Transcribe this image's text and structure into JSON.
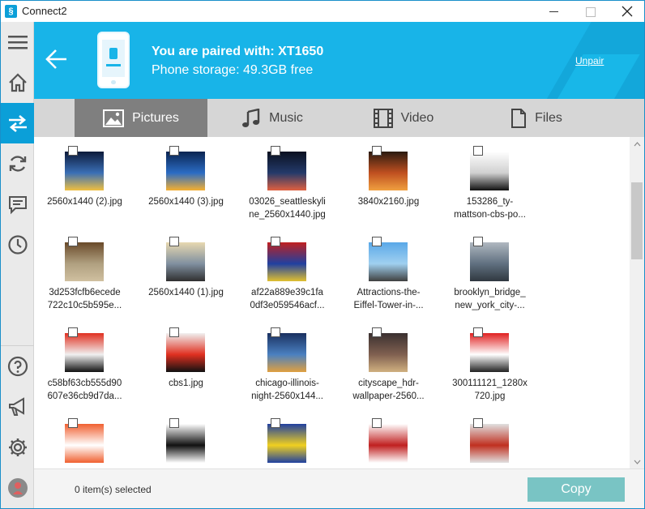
{
  "window": {
    "app_icon": "connect2-logo",
    "title": "Connect2",
    "controls": [
      "minimize",
      "maximize",
      "close"
    ]
  },
  "rail": {
    "top_items": [
      "menu-icon",
      "home-icon",
      "transfer-icon",
      "sync-icon",
      "messages-icon",
      "history-icon"
    ],
    "active": "transfer-icon",
    "bottom_items": [
      "help-icon",
      "announce-icon",
      "settings-icon",
      "profile-icon"
    ]
  },
  "header": {
    "paired_text": "You are paired with: XT1650",
    "storage_text": "Phone storage: 49.3GB free",
    "unpair_label": "Unpair",
    "accent": "#18b4e8"
  },
  "tabs": [
    {
      "label": "Pictures",
      "icon": "picture-icon",
      "active": true
    },
    {
      "label": "Music",
      "icon": "music-icon",
      "active": false
    },
    {
      "label": "Video",
      "icon": "film-icon",
      "active": false
    },
    {
      "label": "Files",
      "icon": "file-icon",
      "active": false
    }
  ],
  "files": [
    {
      "lines": [
        "2560x1440 (2).jpg"
      ],
      "colors": [
        "#0c1a3a",
        "#3a6fb5",
        "#f0c040"
      ]
    },
    {
      "lines": [
        "2560x1440 (3).jpg"
      ],
      "colors": [
        "#0a2450",
        "#2b6cc4",
        "#f5b030"
      ]
    },
    {
      "lines": [
        "03026_seattleskyli",
        "ne_2560x1440.jpg"
      ],
      "colors": [
        "#0a1020",
        "#243a6a",
        "#e06040"
      ]
    },
    {
      "lines": [
        "3840x2160.jpg"
      ],
      "colors": [
        "#2a1a10",
        "#c05020",
        "#f0a040"
      ]
    },
    {
      "lines": [
        "153286_ty-",
        "mattson-cbs-po..."
      ],
      "colors": [
        "#ffffff",
        "#d0d0d0",
        "#111111"
      ]
    },
    {
      "lines": [
        "3d253fcfb6ecede",
        "722c10c5b595e..."
      ],
      "colors": [
        "#6a4a2a",
        "#b0a080",
        "#d0c0a0"
      ]
    },
    {
      "lines": [
        "2560x1440 (1).jpg"
      ],
      "colors": [
        "#e8d8b0",
        "#8090a0",
        "#303030"
      ]
    },
    {
      "lines": [
        "af22a889e39c1fa",
        "0df3e059546acf..."
      ],
      "colors": [
        "#c02020",
        "#2040a0",
        "#e0c030"
      ]
    },
    {
      "lines": [
        "Attractions-the-",
        "Eiffel-Tower-in-..."
      ],
      "colors": [
        "#5aa8e8",
        "#a0d0f0",
        "#404040"
      ]
    },
    {
      "lines": [
        "brooklyn_bridge_",
        "new_york_city-..."
      ],
      "colors": [
        "#b0b8c0",
        "#607080",
        "#303840"
      ]
    },
    {
      "lines": [
        "c58bf63cb555d90",
        "607e36cb9d7da..."
      ],
      "colors": [
        "#e03020",
        "#f0f0f0",
        "#111111"
      ]
    },
    {
      "lines": [
        "cbs1.jpg"
      ],
      "colors": [
        "#f0f0f0",
        "#e03020",
        "#111111"
      ]
    },
    {
      "lines": [
        "chicago-illinois-",
        "night-2560x144..."
      ],
      "colors": [
        "#1a3060",
        "#4a80c0",
        "#e0a040"
      ]
    },
    {
      "lines": [
        "cityscape_hdr-",
        "wallpaper-2560..."
      ],
      "colors": [
        "#3a3030",
        "#806050",
        "#d0b080"
      ]
    },
    {
      "lines": [
        "300111121_1280x",
        "720.jpg"
      ],
      "colors": [
        "#e02020",
        "#ffffff",
        "#222222"
      ]
    },
    {
      "lines": [
        ""
      ],
      "colors": [
        "#f06030",
        "#ffffff",
        "#f06030"
      ]
    },
    {
      "lines": [
        ""
      ],
      "colors": [
        "#ffffff",
        "#111111",
        "#ffffff"
      ]
    },
    {
      "lines": [
        ""
      ],
      "colors": [
        "#2040a0",
        "#f0d020",
        "#2040a0"
      ]
    },
    {
      "lines": [
        ""
      ],
      "colors": [
        "#ffffff",
        "#c02020",
        "#ffffff"
      ]
    },
    {
      "lines": [
        ""
      ],
      "colors": [
        "#e0e0e0",
        "#c03020",
        "#e0e0e0"
      ]
    }
  ],
  "footer": {
    "selected_text": "0 item(s) selected",
    "copy_label": "Copy",
    "copy_color": "#79c4c4"
  }
}
